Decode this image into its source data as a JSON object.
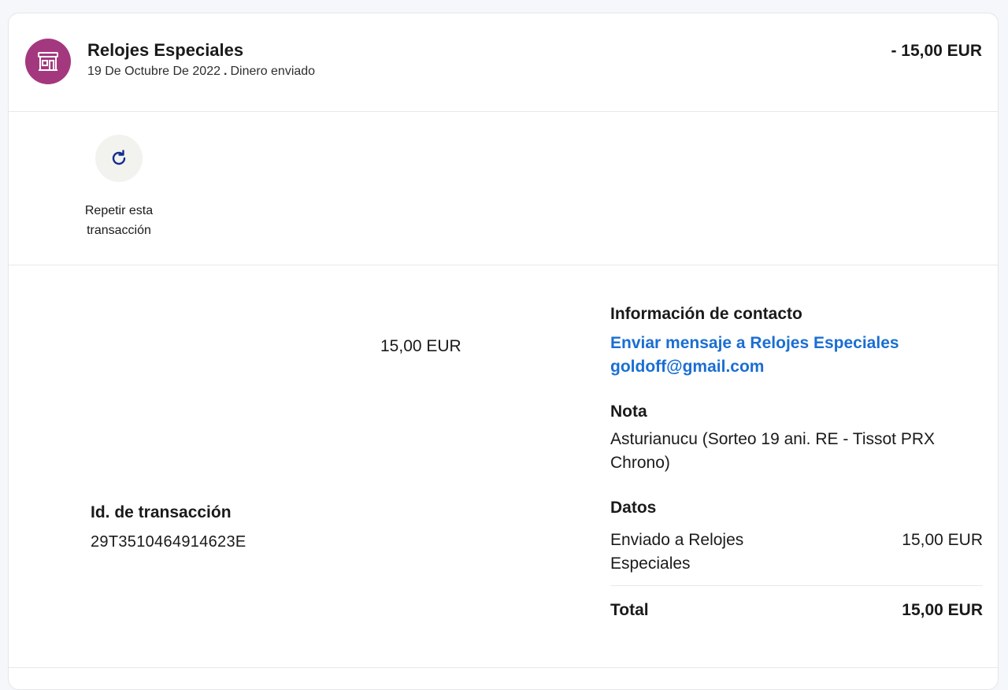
{
  "header": {
    "merchant_name": "Relojes Especiales",
    "date": "19 De Octubre De 2022",
    "separator": ".",
    "type": "Dinero enviado",
    "amount": "- 15,00 EUR",
    "avatar_icon": "store-icon",
    "avatar_color": "#a4387e"
  },
  "actions": {
    "repeat_icon": "refresh-icon",
    "repeat_label_line1": "Repetir esta",
    "repeat_label_line2": "transacción"
  },
  "details": {
    "amount": "15,00 EUR",
    "transaction_id_label": "Id. de transacción",
    "transaction_id": "29T3510464914623E",
    "contact": {
      "title": "Información de contacto",
      "message_link": "Enviar mensaje a Relojes Especiales",
      "email": "goldoff@gmail.com"
    },
    "note": {
      "title": "Nota",
      "text": "Asturianucu (Sorteo 19 ani. RE - Tissot PRX Chrono)"
    },
    "data": {
      "title": "Datos",
      "sent_to_label": "Enviado a Relojes Especiales",
      "sent_to_amount": "15,00 EUR",
      "total_label": "Total",
      "total_amount": "15,00 EUR"
    }
  },
  "colors": {
    "link": "#1a6ed3",
    "avatar": "#a4387e"
  }
}
